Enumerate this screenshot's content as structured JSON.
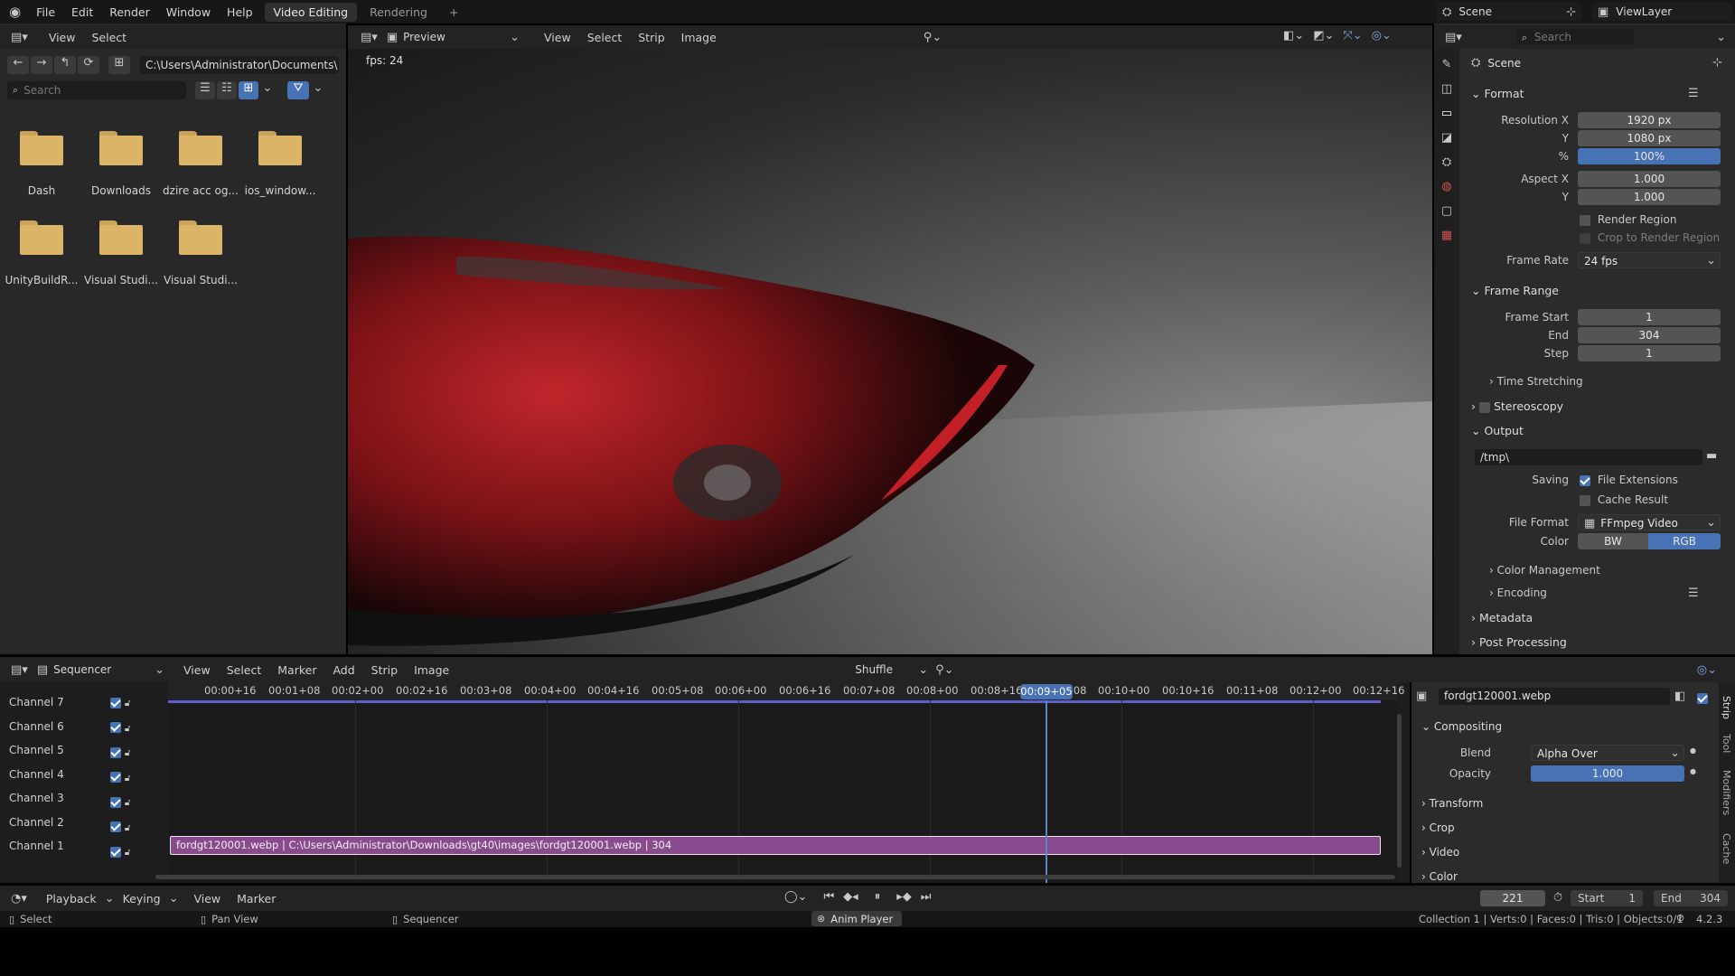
{
  "topbar": {
    "menus": [
      "File",
      "Edit",
      "Render",
      "Window",
      "Help"
    ],
    "tabs": [
      "Video Editing",
      "Rendering"
    ],
    "add_tab": "+",
    "scene": "Scene",
    "view_layer": "ViewLayer"
  },
  "file_browser": {
    "menus": [
      "View",
      "Select"
    ],
    "path": "C:\\Users\\Administrator\\Documents\\",
    "search_placeholder": "Search",
    "items": [
      "Dash",
      "Downloads",
      "dzire acc og...",
      "ios_window...",
      "UnityBuildR...",
      "Visual Studi...",
      "Visual Studi..."
    ]
  },
  "preview": {
    "mode": "Preview",
    "menus": [
      "View",
      "Select",
      "Strip",
      "Image"
    ],
    "fps": "fps: 24"
  },
  "properties": {
    "search_placeholder": "Search",
    "context": "Scene",
    "format_title": "Format",
    "resolution_x_label": "Resolution X",
    "resolution_x": "1920 px",
    "y_label": "Y",
    "resolution_y": "1080 px",
    "pct_label": "%",
    "resolution_pct": "100%",
    "aspect_x_label": "Aspect X",
    "aspect_x": "1.000",
    "aspect_y": "1.000",
    "render_region": "Render Region",
    "crop_region": "Crop to Render Region",
    "frame_rate_label": "Frame Rate",
    "frame_rate": "24 fps",
    "frame_range_title": "Frame Range",
    "frame_start_label": "Frame Start",
    "frame_start": "1",
    "end_label": "End",
    "frame_end": "304",
    "step_label": "Step",
    "frame_step": "1",
    "time_stretching": "Time Stretching",
    "stereoscopy": "Stereoscopy",
    "output_title": "Output",
    "output_path": "/tmp\\",
    "saving_label": "Saving",
    "file_extensions": "File Extensions",
    "cache_result": "Cache Result",
    "file_format_label": "File Format",
    "file_format": "FFmpeg Video",
    "color_label": "Color",
    "color_bw": "BW",
    "color_rgb": "RGB",
    "color_management": "Color Management",
    "encoding": "Encoding",
    "metadata": "Metadata",
    "post_processing": "Post Processing"
  },
  "sequencer": {
    "editor": "Sequencer",
    "menus": [
      "View",
      "Select",
      "Marker",
      "Add",
      "Strip",
      "Image"
    ],
    "overlap_mode": "Shuffle",
    "ticks": [
      "00:00+16",
      "00:01+08",
      "00:02+00",
      "00:02+16",
      "00:03+08",
      "00:04+00",
      "00:04+16",
      "00:05+08",
      "00:06+00",
      "00:06+16",
      "00:07+08",
      "00:08+00",
      "00:08+16",
      "00:09+08",
      "00:10+00",
      "00:10+16",
      "00:11+08",
      "00:12+00",
      "00:12+16"
    ],
    "current_time": "00:09+05",
    "channels": [
      "Channel 7",
      "Channel 6",
      "Channel 5",
      "Channel 4",
      "Channel 3",
      "Channel 2",
      "Channel 1"
    ],
    "strip_label": "fordgt120001.webp | C:\\Users\\Administrator\\Downloads\\gt40\\images\\fordgt120001.webp | 304",
    "sidebar_tabs": [
      "Strip",
      "Tool",
      "Modifiers",
      "Cache"
    ]
  },
  "strip_panel": {
    "name": "fordgt120001.webp",
    "compositing": "Compositing",
    "blend_label": "Blend",
    "blend": "Alpha Over",
    "opacity_label": "Opacity",
    "opacity": "1.000",
    "sections": [
      "Transform",
      "Crop",
      "Video",
      "Color"
    ]
  },
  "timeline": {
    "menus": [
      "Playback",
      "Keying",
      "View",
      "Marker"
    ],
    "current_frame": "221",
    "start_label": "Start",
    "start": "1",
    "end_label": "End",
    "end": "304"
  },
  "statusbar": {
    "select": "Select",
    "pan": "Pan View",
    "sequencer": "Sequencer",
    "anim_player": "Anim Player",
    "stats": "Collection 1 | Verts:0 | Faces:0 | Tris:0 | Objects:0/1",
    "version": "4.2.3"
  }
}
